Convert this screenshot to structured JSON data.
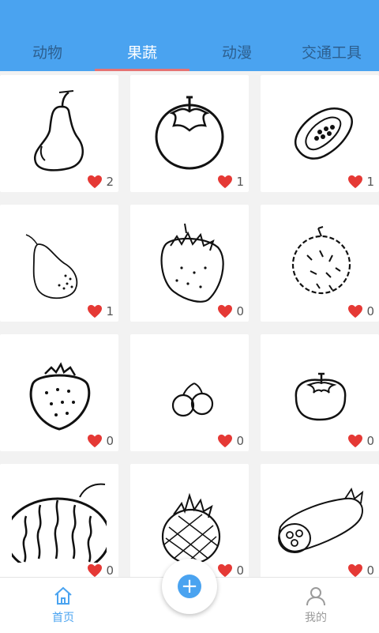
{
  "tabs": [
    {
      "label": "动物"
    },
    {
      "label": "果蔬"
    },
    {
      "label": "动漫"
    },
    {
      "label": "交通工具"
    }
  ],
  "active_tab": "果蔬",
  "cards": [
    {
      "name": "pear",
      "likes": "2"
    },
    {
      "name": "persimmon",
      "likes": "1"
    },
    {
      "name": "papaya",
      "likes": "1"
    },
    {
      "name": "pear-sketch",
      "likes": "1"
    },
    {
      "name": "strawberry",
      "likes": "0"
    },
    {
      "name": "durian",
      "likes": "0"
    },
    {
      "name": "strawberry-2",
      "likes": "0"
    },
    {
      "name": "cherries",
      "likes": "0"
    },
    {
      "name": "tomato",
      "likes": "0"
    },
    {
      "name": "watermelon",
      "likes": "0"
    },
    {
      "name": "pineapple",
      "likes": "0"
    },
    {
      "name": "lotus-root",
      "likes": "0"
    }
  ],
  "bottom_nav": {
    "home_label": "首页",
    "me_label": "我的"
  },
  "colors": {
    "accent": "#4aa3f0",
    "heart": "#e53935",
    "tab_indicator": "#e57373"
  }
}
